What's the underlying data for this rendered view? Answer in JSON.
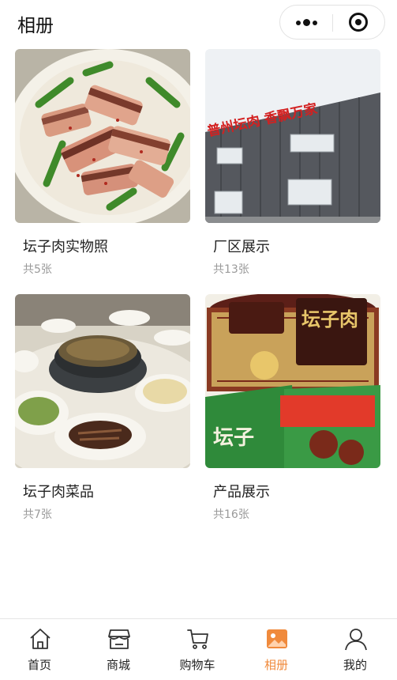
{
  "header": {
    "title": "相册",
    "more_icon": "more-dots-icon",
    "close_icon": "target-close-icon"
  },
  "albums": [
    {
      "name": "坛子肉实物照",
      "count": "共5张",
      "image": "cured-pork-dish-photo"
    },
    {
      "name": "厂区展示",
      "count": "共13张",
      "image": "factory-building-photo"
    },
    {
      "name": "坛子肉菜品",
      "count": "共7张",
      "image": "banquet-dishes-photo"
    },
    {
      "name": "产品展示",
      "count": "共16张",
      "image": "product-packaging-photo"
    }
  ],
  "photo_text": {
    "factory_sign": "普州坛肉 香飘万家",
    "product_box": "坛子肉",
    "product_bag": "坛子"
  },
  "tabbar": {
    "active": "相册",
    "active_color": "#f08a3c",
    "items": [
      {
        "label": "首页",
        "icon": "home-icon"
      },
      {
        "label": "商城",
        "icon": "store-icon"
      },
      {
        "label": "购物车",
        "icon": "cart-icon"
      },
      {
        "label": "相册",
        "icon": "album-icon"
      },
      {
        "label": "我的",
        "icon": "user-icon"
      }
    ]
  }
}
